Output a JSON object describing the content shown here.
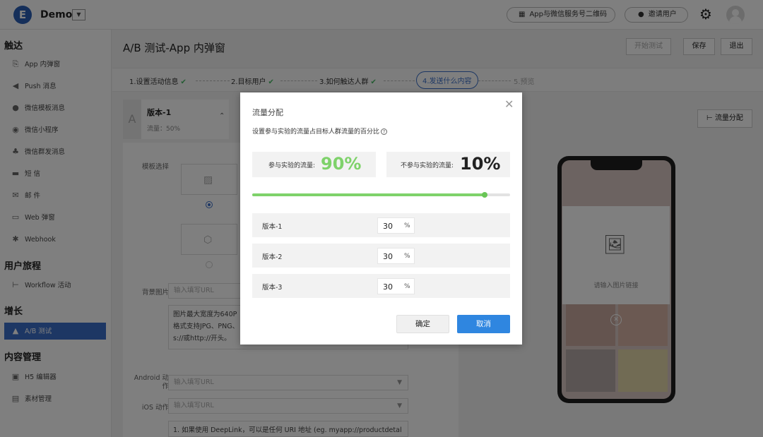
{
  "header": {
    "logo_letter": "E",
    "app_name": "Demo",
    "qr_label": "App与微信服务号二维码",
    "invite_label": "邀请用户"
  },
  "sidebar": {
    "sections": [
      {
        "title": "触达",
        "items": [
          {
            "label": "App 内弹窗",
            "icon": "popup-icon"
          },
          {
            "label": "Push 消息",
            "icon": "megaphone-icon"
          },
          {
            "label": "微信模板消息",
            "icon": "wechat-icon"
          },
          {
            "label": "微信小程序",
            "icon": "miniprogram-icon"
          },
          {
            "label": "微信群发消息",
            "icon": "group-icon"
          },
          {
            "label": "短 信",
            "icon": "sms-icon"
          },
          {
            "label": "邮 件",
            "icon": "mail-icon"
          },
          {
            "label": "Web 弹窗",
            "icon": "web-popup-icon"
          },
          {
            "label": "Webhook",
            "icon": "webhook-icon"
          }
        ]
      },
      {
        "title": "用户旅程",
        "items": [
          {
            "label": "Workflow 活动",
            "icon": "workflow-icon"
          }
        ]
      },
      {
        "title": "增长",
        "items": [
          {
            "label": "A/B 测试",
            "icon": "flask-icon",
            "active": true
          }
        ]
      },
      {
        "title": "内容管理",
        "items": [
          {
            "label": "H5 编辑器",
            "icon": "h5-icon"
          },
          {
            "label": "素材管理",
            "icon": "material-icon"
          }
        ]
      }
    ]
  },
  "main": {
    "title": "A/B 测试-App 内弹窗",
    "actions": {
      "start": "开始测试",
      "save": "保存",
      "exit": "退出"
    },
    "steps": [
      {
        "label": "1.设置活动信息",
        "state": "done"
      },
      {
        "label": "2.目标用户",
        "state": "done"
      },
      {
        "label": "3.如何触达人群",
        "state": "done"
      },
      {
        "label": "4.发送什么内容",
        "state": "current"
      },
      {
        "label": "5.预览",
        "state": "pending"
      }
    ],
    "version_card": {
      "letter": "A",
      "name": "版本-1",
      "flow": "流量：50%"
    },
    "flow_button": "流量分配",
    "form": {
      "template_label": "模板选择",
      "bg_image_label": "背景图片",
      "bg_image_placeholder": "输入填写URL",
      "bg_note": "图片最大宽度为640P\n格式支持JPG、PNG、\ns://或http://开头。",
      "android_label": "Android 动\n作",
      "android_placeholder": "输入填写URL",
      "ios_label": "iOS 动作",
      "ios_placeholder": "输入填写URL",
      "deeplink_note": "1. 如果使用 DeepLink，可以是任何 URI 地址 (eg. myapp://productdetal"
    },
    "preview": {
      "placeholder": "请输入图片链接"
    }
  },
  "modal": {
    "title": "流量分配",
    "description": "设置参与实验的流量占目标人群流量的百分比",
    "in_label": "参与实验的流量:",
    "in_value": "90%",
    "out_label": "不参与实验的流量:",
    "out_value": "10%",
    "slider_percent": 90,
    "versions": [
      {
        "name": "版本-1",
        "value": "30",
        "unit": "%"
      },
      {
        "name": "版本-2",
        "value": "30",
        "unit": "%"
      },
      {
        "name": "版本-3",
        "value": "30",
        "unit": "%"
      }
    ],
    "confirm_label": "确定",
    "cancel_label": "取消"
  },
  "colors": {
    "accent": "#3a6fc8",
    "green": "#7ed26a",
    "primary_button": "#2f86e0"
  }
}
